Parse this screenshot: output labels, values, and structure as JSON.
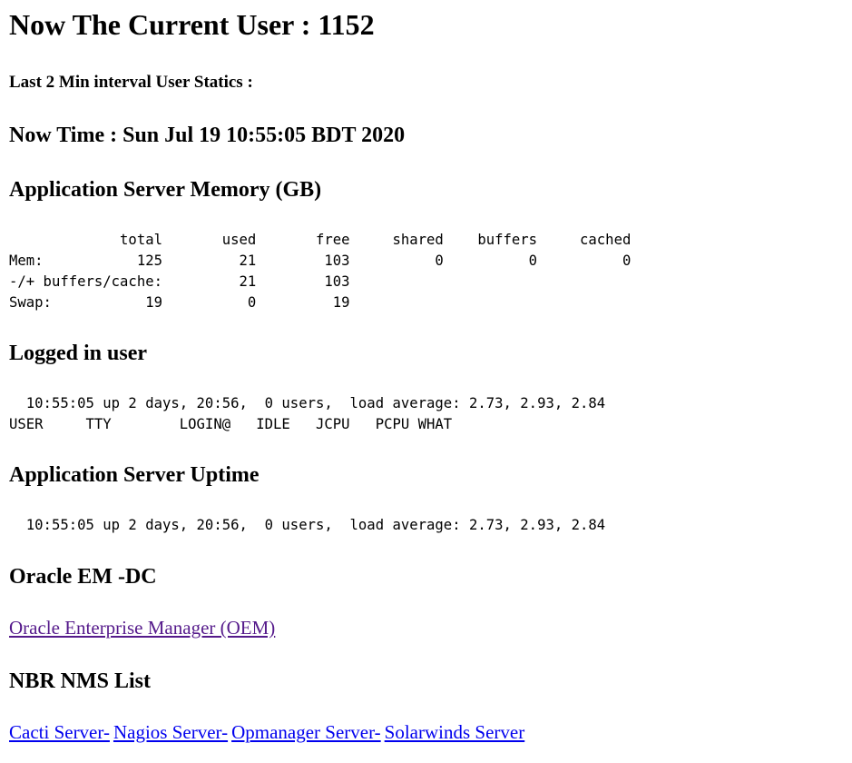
{
  "current_user": {
    "heading": "Now The Current User : 1152"
  },
  "interval_stats": {
    "heading": "Last 2 Min interval User Statics :"
  },
  "now_time": {
    "heading": "Now Time : Sun Jul 19 10:55:05 BDT 2020"
  },
  "memory": {
    "heading": "Application Server Memory (GB)",
    "table_text": "             total       used       free     shared    buffers     cached\nMem:           125         21        103          0          0          0\n-/+ buffers/cache:         21        103\nSwap:           19          0         19"
  },
  "logged_in": {
    "heading": "Logged in user",
    "output_text": "  10:55:05 up 2 days, 20:56,  0 users,  load average: 2.73, 2.93, 2.84\nUSER     TTY        LOGIN@   IDLE   JCPU   PCPU WHAT"
  },
  "uptime": {
    "heading": "Application Server Uptime",
    "output_text": "  10:55:05 up 2 days, 20:56,  0 users,  load average: 2.73, 2.93, 2.84"
  },
  "oracle": {
    "heading": "Oracle EM -DC",
    "link_label": "Oracle Enterprise Manager (OEM)"
  },
  "nms": {
    "heading": "NBR NMS List",
    "links": [
      {
        "label": "Cacti Server-"
      },
      {
        "label": "Nagios Server-"
      },
      {
        "label": "Opmanager Server-"
      },
      {
        "label": "Solarwinds Server"
      }
    ]
  },
  "colors": {
    "visited_link": "#551a8b",
    "link": "#0000ee",
    "text": "#000000",
    "background": "#ffffff"
  }
}
